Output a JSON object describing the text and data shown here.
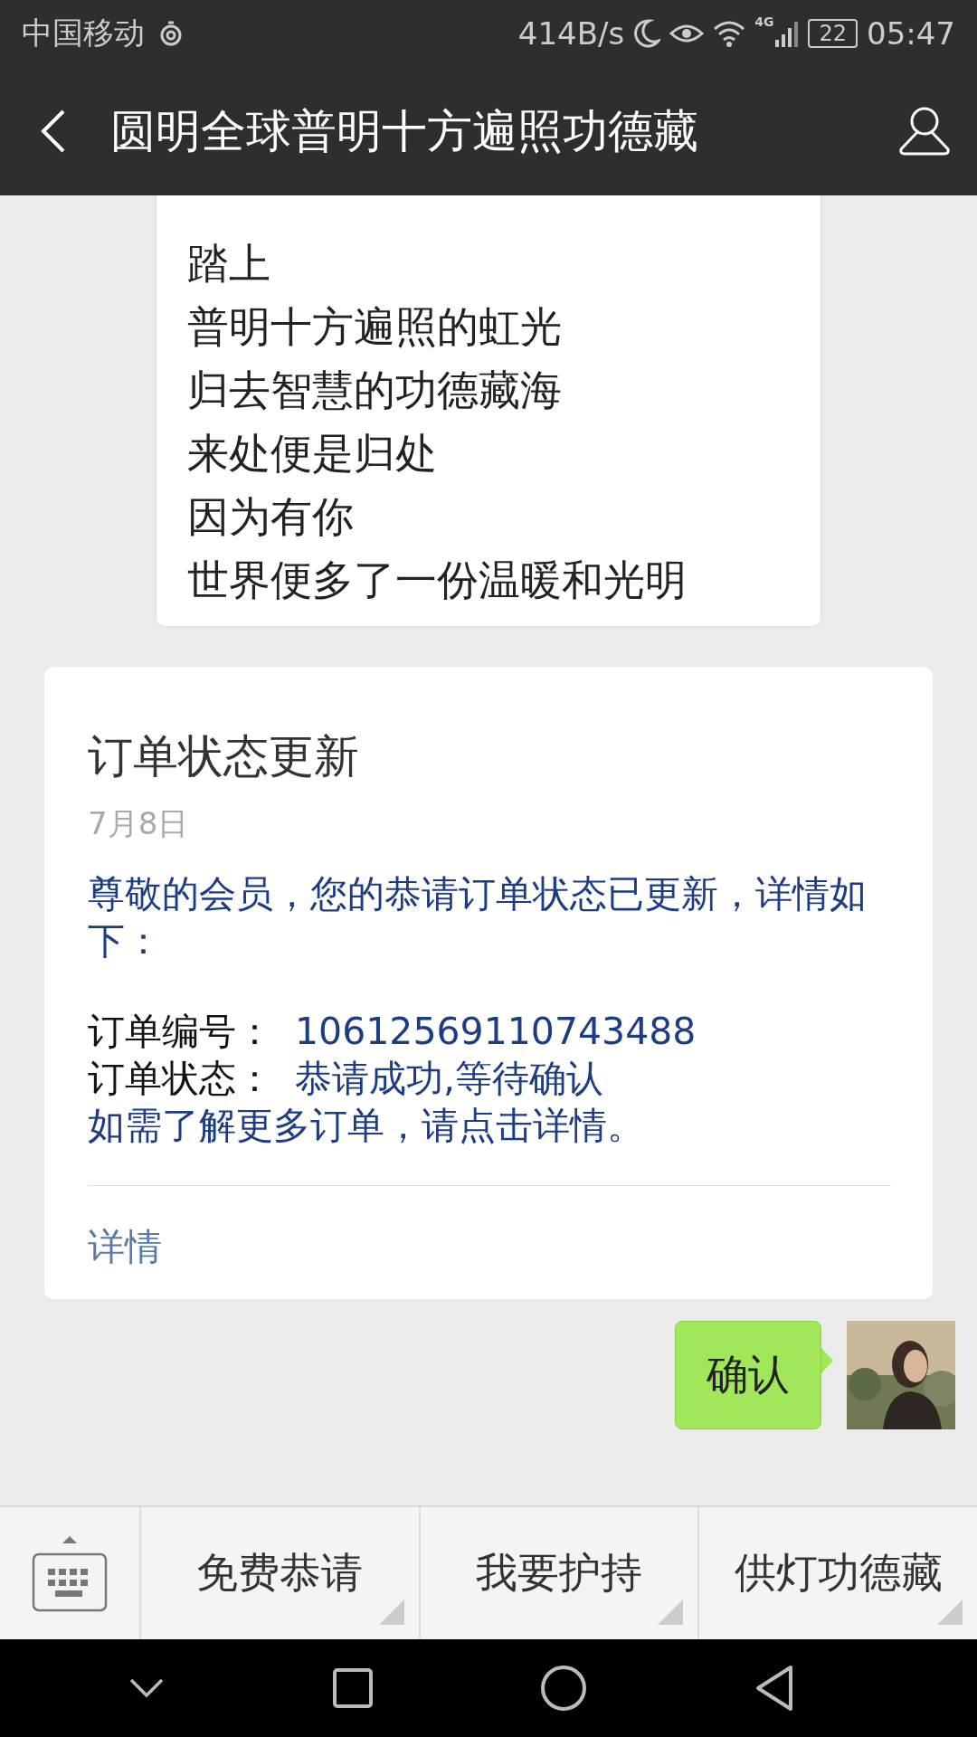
{
  "status_bar": {
    "carrier": "中国移动",
    "speed": "414B/s",
    "network": "4G",
    "battery": "22",
    "time": "05:47"
  },
  "header": {
    "title": "圆明全球普明十方遍照功德藏"
  },
  "messages": [
    {
      "kind": "received",
      "lines": [
        "踏上",
        "普明十方遍照的虹光",
        "归去智慧的功德藏海",
        "来处便是归处",
        "因为有你",
        "世界便多了一份温暖和光明"
      ]
    },
    {
      "kind": "card",
      "title": "订单状态更新",
      "date": "7月8日",
      "intro": "尊敬的会员，您的恭请订单状态已更新，详情如下：",
      "fields": [
        {
          "label": "订单编号：",
          "value": "10612569110743488"
        },
        {
          "label": "订单状态：",
          "value": "恭请成功,等待确认"
        }
      ],
      "note": "如需了解更多订单，请点击详情。",
      "link": "详情"
    },
    {
      "kind": "sent",
      "lines": [
        "确认"
      ]
    }
  ],
  "menu": [
    "免费恭请",
    "我要护持",
    "供灯功德藏"
  ]
}
